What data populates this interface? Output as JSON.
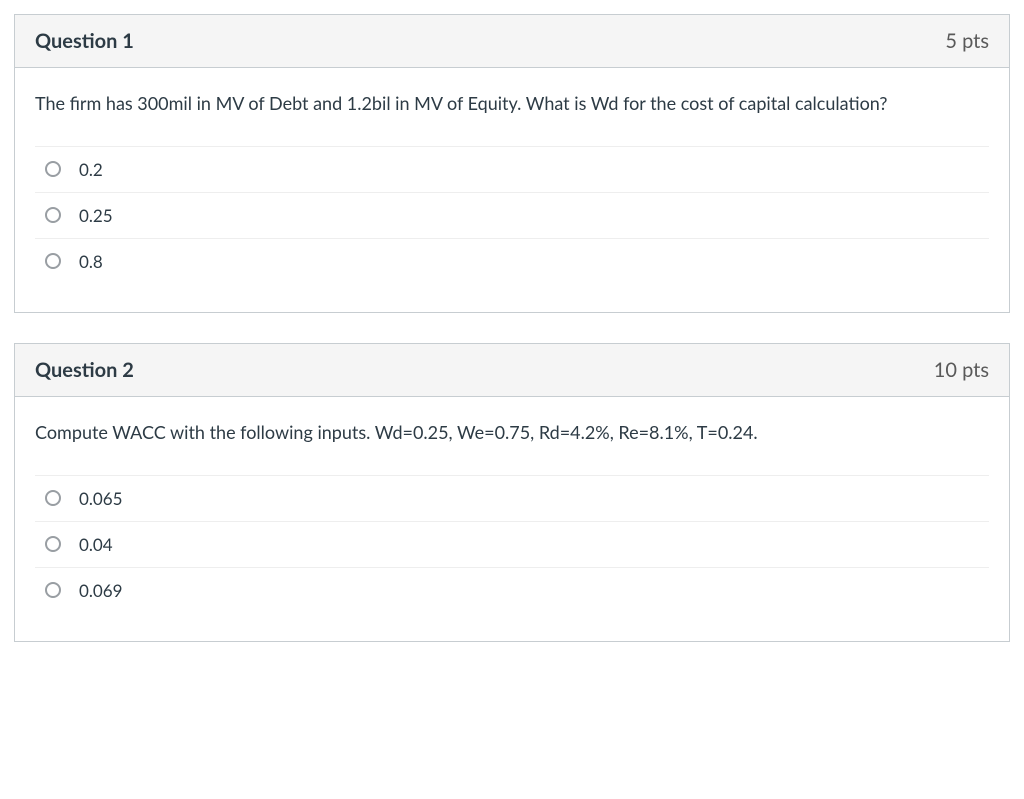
{
  "questions": [
    {
      "title": "Question 1",
      "points": "5 pts",
      "text": "The firm has 300mil in MV of Debt and 1.2bil in MV of Equity. What is Wd for the cost of capital calculation?",
      "answers": [
        "0.2",
        "0.25",
        "0.8"
      ]
    },
    {
      "title": "Question 2",
      "points": "10 pts",
      "text": "Compute WACC  with the following inputs. Wd=0.25, We=0.75, Rd=4.2%, Re=8.1%, T=0.24.",
      "answers": [
        "0.065",
        "0.04",
        "0.069"
      ]
    }
  ]
}
